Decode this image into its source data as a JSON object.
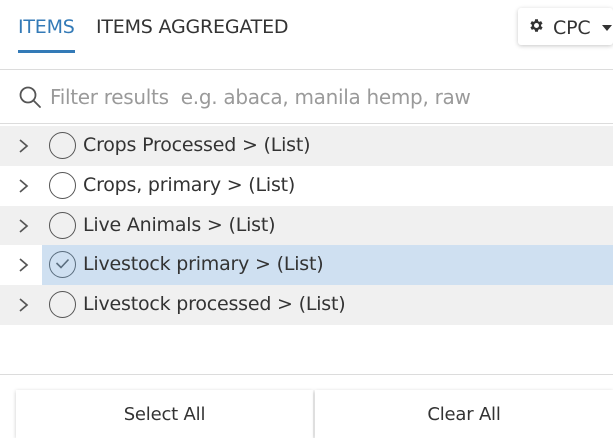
{
  "tabs": {
    "items_label": "ITEMS",
    "aggregated_label": "ITEMS AGGREGATED"
  },
  "classification": {
    "label": "CPC",
    "icon": "gear-icon"
  },
  "search": {
    "placeholder": "Filter results  e.g. abaca, manila hemp, raw",
    "value": ""
  },
  "list": {
    "items": [
      {
        "label": "Crops Processed > (List)",
        "selected": false
      },
      {
        "label": "Crops, primary > (List)",
        "selected": false
      },
      {
        "label": "Live Animals > (List)",
        "selected": false
      },
      {
        "label": "Livestock primary > (List)",
        "selected": true
      },
      {
        "label": "Livestock processed > (List)",
        "selected": false
      }
    ]
  },
  "actions": {
    "select_all_label": "Select All",
    "clear_all_label": "Clear All"
  },
  "colors": {
    "accent": "#337ab7",
    "selected_row": "#cfe0f1",
    "shaded_row": "#f0f0f0"
  }
}
